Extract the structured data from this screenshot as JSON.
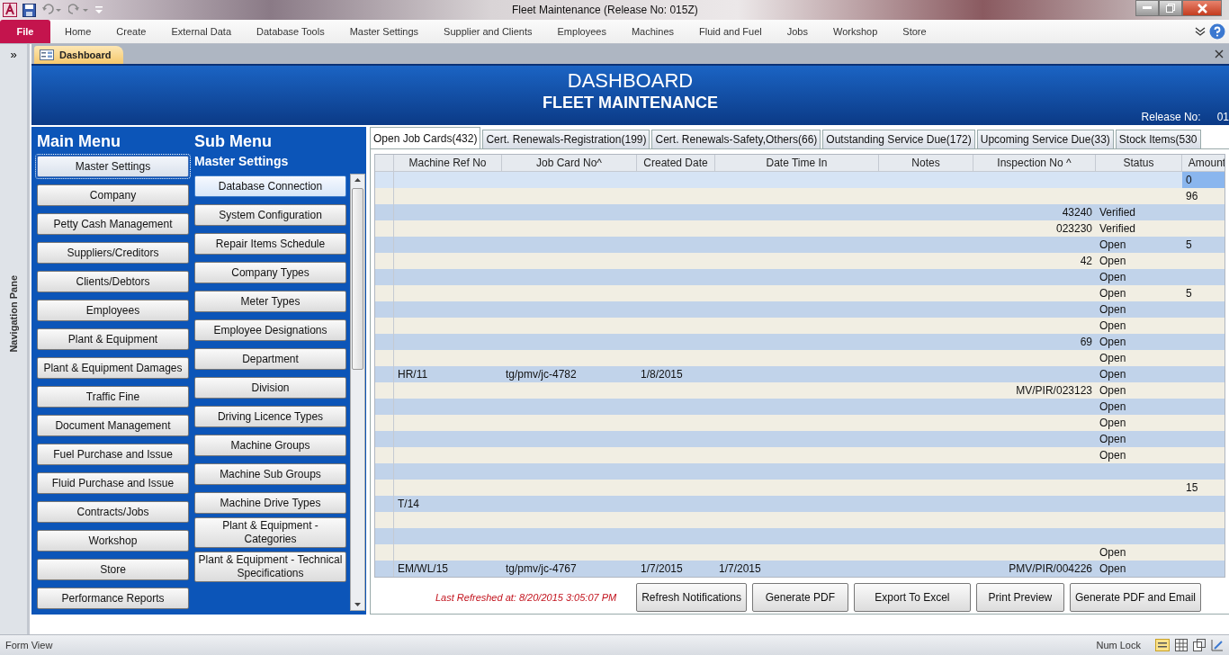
{
  "window": {
    "title": "Fleet Maintenance (Release No: 015Z)"
  },
  "ribbon_tabs": [
    {
      "label": "File",
      "selected": true
    },
    {
      "label": "Home",
      "selected": false
    },
    {
      "label": "Create",
      "selected": false
    },
    {
      "label": "External Data",
      "selected": false
    },
    {
      "label": "Database Tools",
      "selected": false
    },
    {
      "label": "Master Settings",
      "selected": false
    },
    {
      "label": "Supplier and Clients",
      "selected": false
    },
    {
      "label": "Employees",
      "selected": false
    },
    {
      "label": "Machines",
      "selected": false
    },
    {
      "label": "Fluid and Fuel",
      "selected": false
    },
    {
      "label": "Jobs",
      "selected": false
    },
    {
      "label": "Workshop",
      "selected": false
    },
    {
      "label": "Store",
      "selected": false
    }
  ],
  "nav_toggle": "»",
  "navigation_pane": {
    "label": "Navigation Pane"
  },
  "document_tabs": [
    {
      "label": "Dashboard",
      "selected": true
    }
  ],
  "header": {
    "title": "DASHBOARD",
    "subtitle": "FLEET MAINTENANCE",
    "release_label": "Release No:",
    "release_value": "01"
  },
  "main_menu": {
    "title": "Main Menu",
    "items": [
      {
        "label": "Master Settings",
        "selected": true
      },
      {
        "label": "Company",
        "selected": false
      },
      {
        "label": "Petty Cash Management",
        "selected": false
      },
      {
        "label": "Suppliers/Creditors",
        "selected": false
      },
      {
        "label": "Clients/Debtors",
        "selected": false
      },
      {
        "label": "Employees",
        "selected": false
      },
      {
        "label": "Plant & Equipment",
        "selected": false
      },
      {
        "label": "Plant & Equipment Damages",
        "selected": false
      },
      {
        "label": "Traffic Fine",
        "selected": false
      },
      {
        "label": "Document Management",
        "selected": false
      },
      {
        "label": "Fuel Purchase and Issue",
        "selected": false
      },
      {
        "label": "Fluid Purchase and Issue",
        "selected": false
      },
      {
        "label": "Contracts/Jobs",
        "selected": false
      },
      {
        "label": "Workshop",
        "selected": false
      },
      {
        "label": "Store",
        "selected": false
      },
      {
        "label": "Performance Reports",
        "selected": false
      }
    ]
  },
  "sub_menu": {
    "title": "Sub Menu",
    "heading": "Master Settings",
    "items": [
      {
        "label": "Database Connection",
        "selected": true
      },
      {
        "label": "System Configuration",
        "selected": false
      },
      {
        "label": "Repair Items Schedule",
        "selected": false
      },
      {
        "label": "Company Types",
        "selected": false
      },
      {
        "label": "Meter Types",
        "selected": false
      },
      {
        "label": "Employee Designations",
        "selected": false
      },
      {
        "label": "Department",
        "selected": false
      },
      {
        "label": "Division",
        "selected": false
      },
      {
        "label": "Driving Licence Types",
        "selected": false
      },
      {
        "label": "Machine Groups",
        "selected": false
      },
      {
        "label": "Machine Sub Groups",
        "selected": false
      },
      {
        "label": "Machine Drive Types",
        "selected": false
      },
      {
        "label": "Plant & Equipment - Categories",
        "selected": false
      },
      {
        "label": "Plant & Equipment - Technical Specifications",
        "selected": false
      }
    ]
  },
  "tabs": [
    {
      "label": "Open Job Cards(432)",
      "selected": true
    },
    {
      "label": "Cert. Renewals-Registration(199)",
      "selected": false
    },
    {
      "label": "Cert. Renewals-Safety,Others(66)",
      "selected": false
    },
    {
      "label": "Outstanding Service Due(172)",
      "selected": false
    },
    {
      "label": "Upcoming Service Due(33)",
      "selected": false
    },
    {
      "label": "Stock Items(530",
      "selected": false
    }
  ],
  "table": {
    "columns": [
      "Machine Ref No",
      "Job Card No^",
      "Created Date",
      "Date Time In",
      "Notes",
      "Inspection No ^",
      "Status",
      "Amount"
    ],
    "rows": [
      {
        "selected": true,
        "amount": "0"
      },
      {
        "selected": false,
        "amount": "96"
      },
      {
        "selected": false,
        "inspection": "43240",
        "status": "Verified"
      },
      {
        "selected": false,
        "inspection": "023230",
        "status": "Verified"
      },
      {
        "selected": false,
        "status": "Open",
        "amount": "5"
      },
      {
        "selected": false,
        "inspection": "42",
        "status": "Open"
      },
      {
        "selected": false,
        "status": "Open"
      },
      {
        "selected": false,
        "status": "Open",
        "amount": "5"
      },
      {
        "selected": false,
        "status": "Open"
      },
      {
        "selected": false,
        "status": "Open"
      },
      {
        "selected": false,
        "inspection": "69",
        "status": "Open"
      },
      {
        "selected": false,
        "status": "Open"
      },
      {
        "selected": false,
        "machine_ref": "HR/11",
        "job_card": "tg/pmv/jc-4782",
        "created": "1/8/2015",
        "status": "Open"
      },
      {
        "selected": false,
        "inspection": "MV/PIR/023123",
        "status": "Open"
      },
      {
        "selected": false,
        "status": "Open"
      },
      {
        "selected": false,
        "status": "Open"
      },
      {
        "selected": false,
        "status": "Open"
      },
      {
        "selected": false,
        "status": "Open"
      },
      {
        "selected": false
      },
      {
        "selected": false,
        "amount": "15"
      },
      {
        "selected": false,
        "machine_ref": "T/14"
      },
      {
        "selected": false
      },
      {
        "selected": false
      },
      {
        "selected": false,
        "status": "Open"
      },
      {
        "selected": false,
        "machine_ref": "EM/WL/15",
        "job_card": "tg/pmv/jc-4767",
        "created": "1/7/2015",
        "date_in": "1/7/2015",
        "inspection": "PMV/PIR/004226",
        "status": "Open"
      }
    ]
  },
  "last_refreshed": "Last Refreshed at: 8/20/2015 3:05:07 PM",
  "buttons": [
    "Refresh Notifications",
    "Generate PDF",
    "Export To Excel",
    "Print Preview",
    "Generate PDF and Email"
  ],
  "status_bar": {
    "left": "Form View",
    "right": "Num Lock"
  }
}
